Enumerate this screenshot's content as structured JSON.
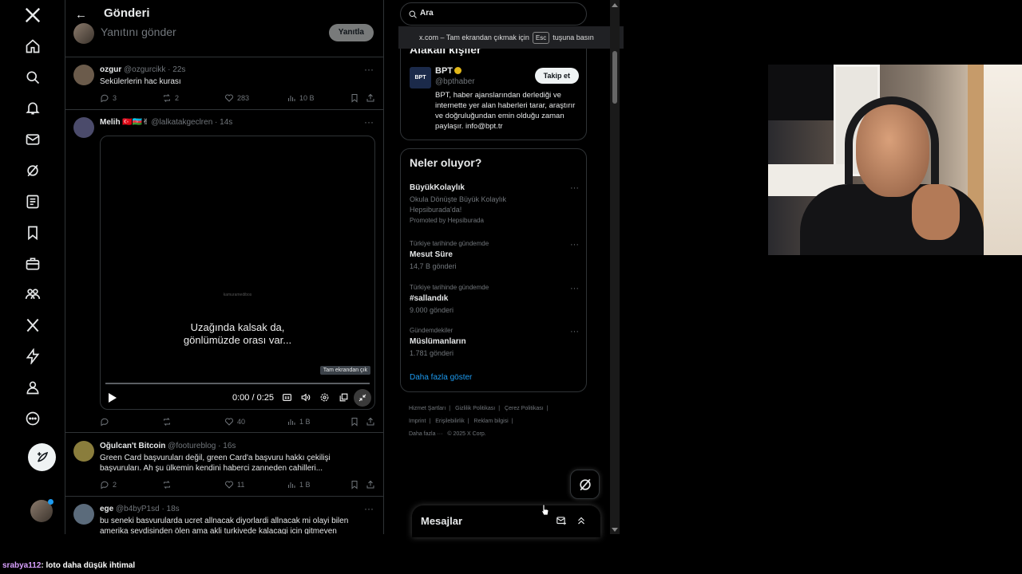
{
  "header": {
    "title": "Gönderi"
  },
  "reply": {
    "placeholder": "Yanıtını gönder",
    "button": "Yanıtla"
  },
  "tweets": [
    {
      "name": "ozgur",
      "handle": "@ozgurcikk",
      "time": "· 22s",
      "text": "Sekülerlerin hac kurası",
      "replies": "3",
      "retweets": "2",
      "likes": "283",
      "views": "10 B",
      "avatar_color": "#6b5b4b"
    },
    {
      "name": "Melih",
      "flags": "🇹🇷🇦🇿✌",
      "handle": "@lalkatakgeclren",
      "time": "· 14s",
      "replies": "",
      "retweets": "",
      "likes": "40",
      "views": "1 B",
      "avatar_color": "#4b4b6b"
    },
    {
      "name": "Oğulcan't Bitcoin",
      "handle": "@footureblog",
      "time": "· 16s",
      "text": "Green Card başvuruları değil, green Card'a başvuru hakkı çekilişi başvuruları. Ah şu ülkemin kendini haberci zanneden cahilleri...",
      "replies": "2",
      "retweets": "",
      "likes": "11",
      "views": "1 B",
      "avatar_color": "#8a7d3c"
    },
    {
      "name": "ege",
      "handle": "@b4byP1sd",
      "time": "· 18s",
      "text": "bu seneki basvurularda ucret allnacak diyorlardi allnacak mi olayi bilen amerika sevdisinden ölen ama akli turkivede kalacagi icin gitmeven",
      "avatar_color": "#5b6b7b"
    }
  ],
  "video": {
    "watermark": "kamuramedibos",
    "caption_line1": "Uzağında kalsak da,",
    "caption_line2": "gönlümüzde orası var...",
    "tooltip": "Tam ekrandan çık",
    "time": "0:00 / 0:25",
    "progress": 0
  },
  "search": {
    "value": "Ara"
  },
  "fullscreen_toast": {
    "text_before": "x.com – Tam ekrandan çıkmak için",
    "key": "Esc",
    "text_after": "tuşuna basın"
  },
  "related": {
    "title": "Alakalı kişiler",
    "account": {
      "logo": "BPT",
      "name": "BPT",
      "handle": "@bpthaber",
      "follow": "Takip et",
      "bio": "BPT, haber ajanslarından derlediği ve internette yer alan haberleri tarar, araştırır ve doğruluğundan emin olduğu zaman paylaşır. info@bpt.tr"
    }
  },
  "trends": {
    "title": "Neler oluyor?",
    "items": [
      {
        "context": "",
        "name": "BüyükKolaylık",
        "sub": "Okula Dönüşte Büyük Kolaylık Hepsiburada'da!",
        "promo": "Promoted by Hepsiburada"
      },
      {
        "context": "Türkiye tarihinde gündemde",
        "name": "Mesut Süre",
        "sub": "14,7 B gönderi"
      },
      {
        "context": "Türkiye tarihinde gündemde",
        "name": "#sallandık",
        "sub": "9.000 gönderi"
      },
      {
        "context": "Gündemdekiler",
        "name": "Müslümanların",
        "sub": "1.781 gönderi"
      }
    ],
    "show_more": "Daha fazla göster"
  },
  "footer": {
    "links": [
      "Hizmet Şartları",
      "|",
      "Gizlilik Politikası",
      "|",
      "Çerez Politikası",
      "|",
      "Imprint",
      "|",
      "Erişilebilirlik",
      "|",
      "Reklam bilgisi",
      "|",
      "Daha fazla ···",
      "© 2025 X Corp."
    ]
  },
  "messages": {
    "title": "Mesajlar"
  },
  "chat": {
    "user": "srabya112",
    "message": ": loto daha düşük ihtimal"
  }
}
